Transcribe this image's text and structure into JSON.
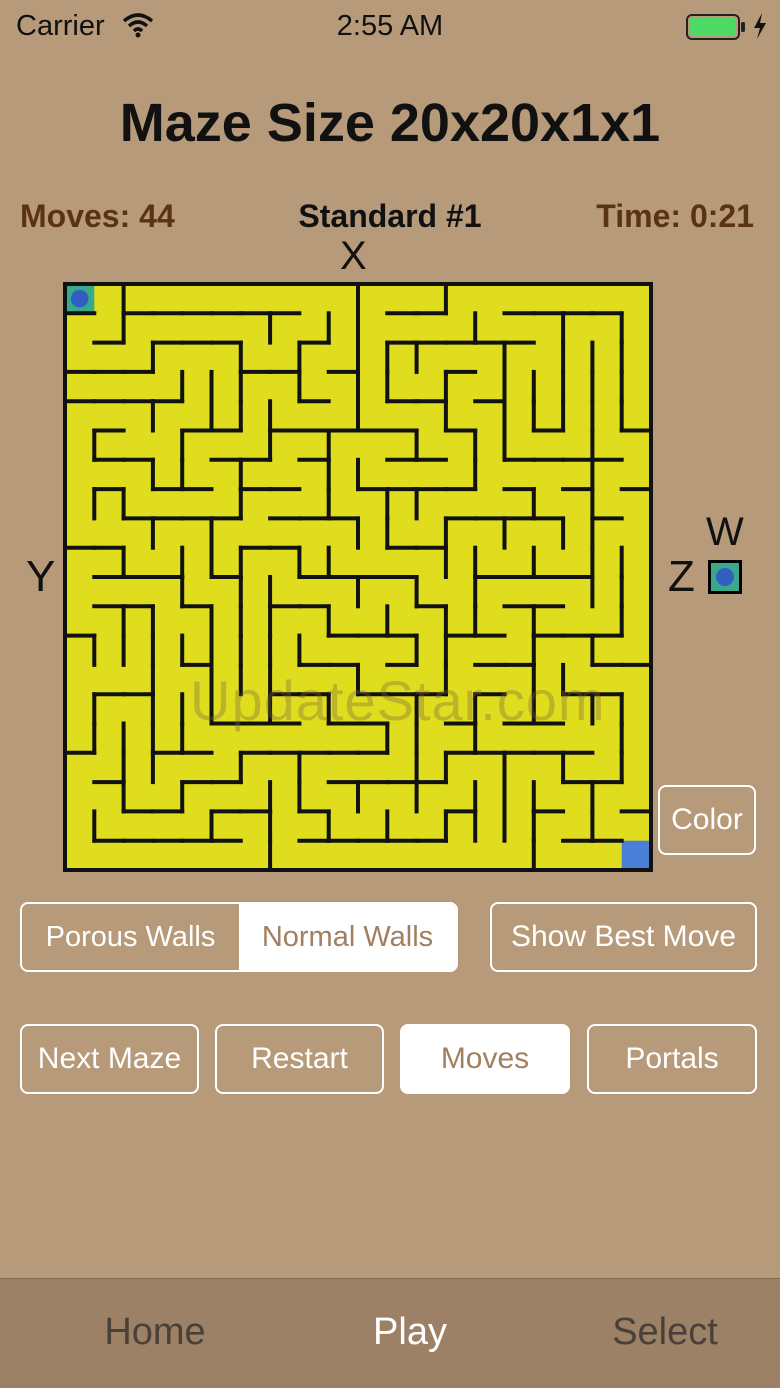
{
  "status_bar": {
    "carrier": "Carrier",
    "time": "2:55 AM"
  },
  "title": "Maze Size 20x20x1x1",
  "info": {
    "moves": "Moves: 44",
    "maze_name": "Standard #1",
    "time": "Time: 0:21"
  },
  "axes": {
    "x": "X",
    "y": "Y",
    "z": "Z",
    "w": "W"
  },
  "maze": {
    "cols": 20,
    "rows": 20,
    "player": [
      0,
      0
    ],
    "goal": [
      19,
      19
    ],
    "wall_color": "#111111",
    "floor_color": "#e0dd1e",
    "player_cell_color": "#3aa88a",
    "player_dot_color": "#2f60c0",
    "goal_color": "#4a7fd8"
  },
  "buttons": {
    "color": "Color",
    "porous_walls": "Porous Walls",
    "normal_walls": "Normal Walls",
    "show_best_move": "Show Best Move",
    "next_maze": "Next Maze",
    "restart": "Restart",
    "moves": "Moves",
    "portals": "Portals"
  },
  "watermark": "UpdateStar.com",
  "tabs": {
    "home": "Home",
    "play": "Play",
    "select": "Select"
  },
  "colors": {
    "background": "#b79a7a",
    "info_text": "#5a3214",
    "tab_bar": "#9c8166"
  }
}
